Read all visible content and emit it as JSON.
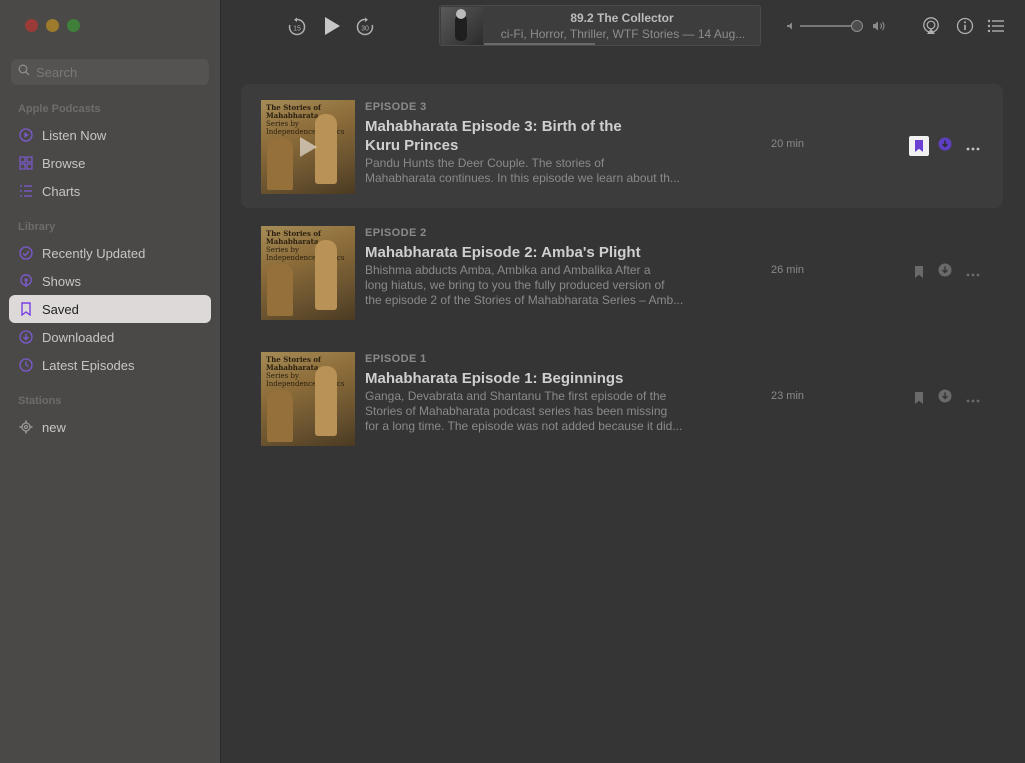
{
  "window": {
    "traffic_lights": [
      "close",
      "minimize",
      "zoom"
    ]
  },
  "sidebar": {
    "search_placeholder": "Search",
    "sections": [
      {
        "header": "Apple Podcasts",
        "items": [
          {
            "label": "Listen Now",
            "icon": "play-circle-icon"
          },
          {
            "label": "Browse",
            "icon": "grid-icon"
          },
          {
            "label": "Charts",
            "icon": "list-icon"
          }
        ]
      },
      {
        "header": "Library",
        "items": [
          {
            "label": "Recently Updated",
            "icon": "refresh-icon"
          },
          {
            "label": "Shows",
            "icon": "podcast-icon"
          },
          {
            "label": "Saved",
            "icon": "bookmark-icon",
            "active": true
          },
          {
            "label": "Downloaded",
            "icon": "download-circle-icon"
          },
          {
            "label": "Latest Episodes",
            "icon": "clock-icon"
          }
        ]
      },
      {
        "header": "Stations",
        "items": [
          {
            "label": "new",
            "icon": "gear-icon"
          }
        ]
      }
    ]
  },
  "toolbar": {
    "skip_back_seconds": "15",
    "skip_forward_seconds": "30",
    "now_playing": {
      "title": "89.2 The Collector",
      "subtitle": "ci-Fi, Horror, Thriller, WTF Stories — 14 Aug..."
    },
    "progress_fraction": 0.4,
    "volume_fraction": 0.85
  },
  "episodes": [
    {
      "label": "EPISODE 3",
      "title": "Mahabharata Episode 3: Birth of the Kuru Princes",
      "desc_lines": [
        "Pandu Hunts the Deer Couple.  The stories of",
        "Mahabharata continues. In this episode we learn about th..."
      ],
      "duration": "20 min",
      "saved": true,
      "highlight": true
    },
    {
      "label": "EPISODE 2",
      "title": "Mahabharata Episode 2: Amba's Plight",
      "desc_lines": [
        "Bhishma abducts Amba, Ambika and Ambalika  After a",
        "long hiatus, we bring to you the fully produced version of",
        "the episode 2 of the Stories of Mahabharata Series – Amb..."
      ],
      "duration": "26 min",
      "saved": false,
      "highlight": false
    },
    {
      "label": "EPISODE 1",
      "title": "Mahabharata Episode 1: Beginnings",
      "desc_lines": [
        "Ganga, Devabrata and Shantanu  The first episode of the",
        "Stories of Mahabharata podcast series has been missing",
        "for a long time. The episode was not added because it did..."
      ],
      "duration": "23 min",
      "saved": false,
      "highlight": false
    }
  ],
  "artwork_text": {
    "line1": "The Stories of Mahabharata",
    "line2": "Series by",
    "line3": "Independence Comics"
  },
  "colors": {
    "accent": "#6b3fd4",
    "sidebar_bg": "#4b4948",
    "content_bg": "#353535",
    "active_item_bg": "#dcd9d8"
  }
}
